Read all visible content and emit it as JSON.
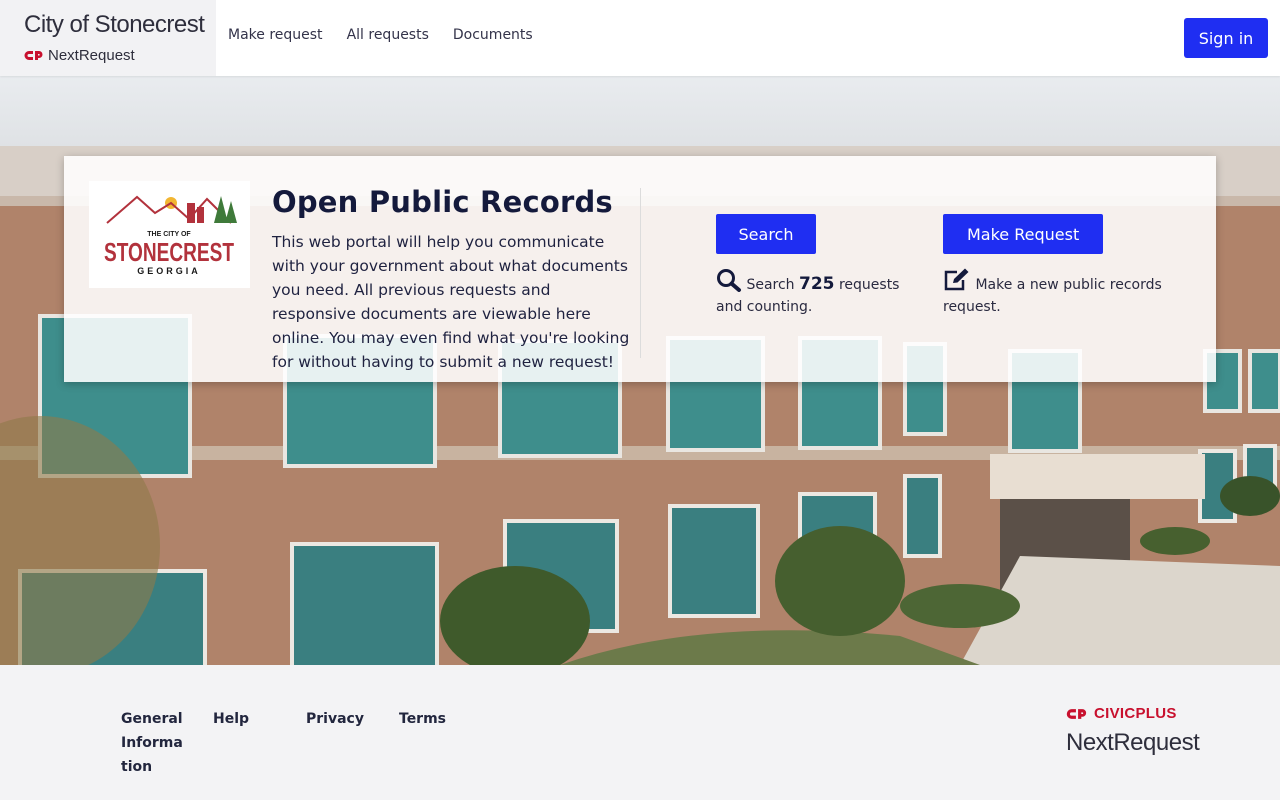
{
  "header": {
    "brand_title": "City of Stonecrest",
    "brand_sub": "NextRequest",
    "nav": [
      "Make request",
      "All requests",
      "Documents"
    ],
    "signin_label": "Sign in"
  },
  "card": {
    "logo": {
      "line1": "THE CITY OF",
      "line2": "STONECREST",
      "line3": "GEORGIA"
    },
    "title": "Open Public Records",
    "description": "This web portal will help you communicate with your government about what documents you need. All previous requests and responsive documents are viewable here online. You may even find what you're looking for without having to submit a new request!",
    "search": {
      "button": "Search",
      "text_pre": "Search",
      "count": "725",
      "text_post": "requests and counting.",
      "icon": "search-icon"
    },
    "make": {
      "button": "Make Request",
      "text": "Make a new public records request.",
      "icon": "edit-icon"
    }
  },
  "footer": {
    "links": [
      "General Information",
      "Help",
      "Privacy",
      "Terms"
    ],
    "civicplus": "CIVICPLUS",
    "nextrequest": "NextRequest"
  },
  "colors": {
    "primary": "#1f2ef2",
    "brand_red": "#c8102e",
    "title": "#141a3c"
  }
}
